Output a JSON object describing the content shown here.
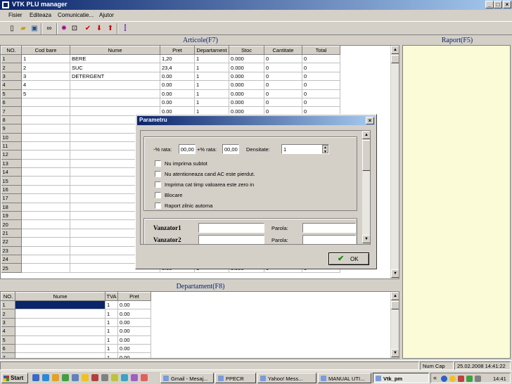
{
  "window": {
    "title": "VTK PLU manager"
  },
  "menu": [
    "Fisier",
    "Editeaza",
    "Comunicatie...",
    "Ajutor"
  ],
  "toolbar_icons": [
    "new-doc-icon",
    "open-folder-icon",
    "save-icon",
    "binoculars-icon",
    "settings-gear-icon",
    "device-icon",
    "check-icon",
    "arrow-down-icon",
    "arrow-up-icon",
    "export-icon"
  ],
  "articole": {
    "title": "Articole(F7)",
    "columns": [
      "NO.",
      "Cod bare",
      "Nume",
      "Pret",
      "Departament",
      "Stoc",
      "Cantitate",
      "Total"
    ],
    "rows": [
      [
        "1",
        "1",
        "BERE",
        "1,20",
        "1",
        "0.000",
        "0",
        "0"
      ],
      [
        "2",
        "2",
        "SUC",
        "23,4",
        "1",
        "0.000",
        "0",
        "0"
      ],
      [
        "3",
        "3",
        "DETERGENT",
        "0.00",
        "1",
        "0.000",
        "0",
        "0"
      ],
      [
        "4",
        "4",
        "",
        "0.00",
        "1",
        "0.000",
        "0",
        "0"
      ],
      [
        "5",
        "5",
        "",
        "0.00",
        "1",
        "0.000",
        "0",
        "0"
      ],
      [
        "6",
        "",
        "",
        "0.00",
        "1",
        "0.000",
        "0",
        "0"
      ],
      [
        "7",
        "",
        "",
        "0.00",
        "1",
        "0.000",
        "0",
        "0"
      ],
      [
        "8",
        "",
        "",
        "",
        "",
        "",
        "",
        ""
      ],
      [
        "9",
        "",
        "",
        "",
        "",
        "",
        "",
        ""
      ],
      [
        "10",
        "",
        "",
        "",
        "",
        "",
        "",
        ""
      ],
      [
        "11",
        "",
        "",
        "",
        "",
        "",
        "",
        ""
      ],
      [
        "12",
        "",
        "",
        "",
        "",
        "",
        "",
        ""
      ],
      [
        "13",
        "",
        "",
        "",
        "",
        "",
        "",
        ""
      ],
      [
        "14",
        "",
        "",
        "",
        "",
        "",
        "",
        ""
      ],
      [
        "15",
        "",
        "",
        "",
        "",
        "",
        "",
        ""
      ],
      [
        "16",
        "",
        "",
        "",
        "",
        "",
        "",
        ""
      ],
      [
        "17",
        "",
        "",
        "",
        "",
        "",
        "",
        ""
      ],
      [
        "18",
        "",
        "",
        "",
        "",
        "",
        "",
        ""
      ],
      [
        "19",
        "",
        "",
        "",
        "",
        "",
        "",
        ""
      ],
      [
        "20",
        "",
        "",
        "",
        "",
        "",
        "",
        ""
      ],
      [
        "21",
        "",
        "",
        "",
        "",
        "",
        "",
        ""
      ],
      [
        "22",
        "",
        "",
        "",
        "",
        "",
        "",
        ""
      ],
      [
        "23",
        "",
        "",
        "",
        "",
        "",
        "",
        ""
      ],
      [
        "24",
        "",
        "",
        "",
        "",
        "",
        "",
        ""
      ],
      [
        "25",
        "",
        "",
        "0.00",
        "1",
        "0.000",
        "0",
        "0"
      ]
    ]
  },
  "raport": {
    "title": "Raport(F5)"
  },
  "departament": {
    "title": "Departament(F8)",
    "columns": [
      "NO.",
      "Nume",
      "TVA",
      "Pret"
    ],
    "rows": [
      [
        "1",
        "",
        "1",
        "0.00"
      ],
      [
        "2",
        "",
        "1",
        "0.00"
      ],
      [
        "3",
        "",
        "1",
        "0.00"
      ],
      [
        "4",
        "",
        "1",
        "0.00"
      ],
      [
        "5",
        "",
        "1",
        "0.00"
      ],
      [
        "6",
        "",
        "1",
        "0.00"
      ],
      [
        "7",
        "",
        "1",
        "0.00"
      ]
    ]
  },
  "dialog": {
    "title": "Parametru",
    "minus_rata_label": "-% rata:",
    "minus_rata_value": "00,00",
    "plus_rata_label": "+% rata:",
    "plus_rata_value": "00,00",
    "densitate_label": "Densitate:",
    "densitate_value": "1",
    "checkboxes": [
      "Nu imprima subtot",
      "Nu atentioneaza cand AC este pierdut.",
      "Imprima cat timp valoarea este zero in",
      "Blocare",
      "Raport zilnic automa"
    ],
    "vanzator1_label": "Vanzator1",
    "vanzator2_label": "Vanzator2",
    "parola_label": "Parola:",
    "ok_label": "OK"
  },
  "status": {
    "mode": "Num  Cap",
    "datetime": "25.02.2008 14:41:22"
  },
  "taskbar": {
    "start_label": "Start",
    "tasks": [
      "Gmail - Mesaj...",
      "PPECR",
      "Yahoo! Mess...",
      "MANUAL UTI...",
      "Vtk_pm"
    ],
    "clock": "14:41"
  }
}
